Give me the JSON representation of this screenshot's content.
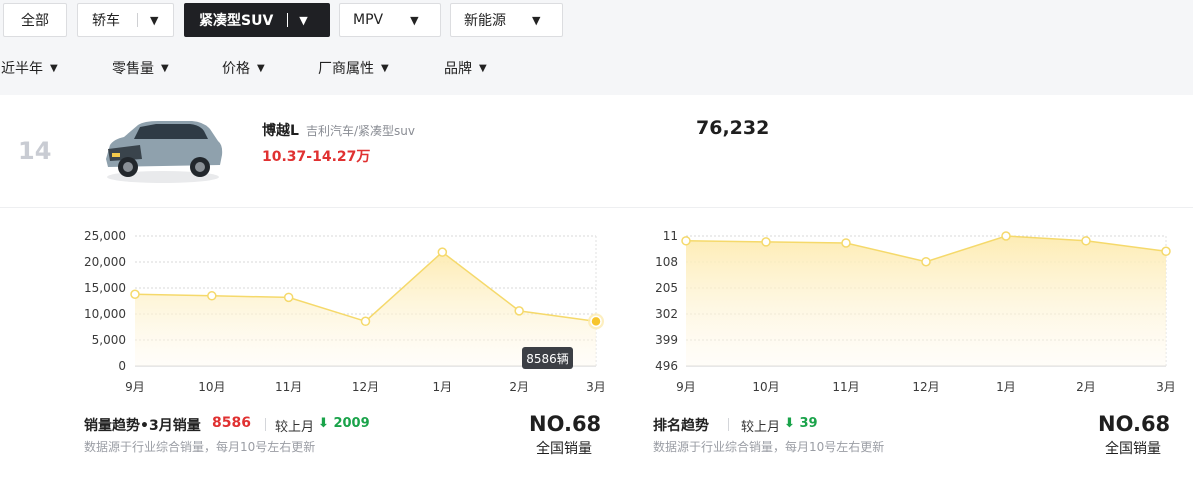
{
  "tabs": [
    {
      "label": "全部",
      "dropdown": false,
      "active": false
    },
    {
      "label": "轿车",
      "dropdown": true,
      "active": false
    },
    {
      "label": "紧凑型SUV",
      "dropdown": true,
      "active": true
    },
    {
      "label": "MPV",
      "dropdown": true,
      "active": false
    },
    {
      "label": "新能源",
      "dropdown": true,
      "active": false
    }
  ],
  "filters": [
    "近半年",
    "零售量",
    "价格",
    "厂商属性",
    "品牌"
  ],
  "item": {
    "rank": "14",
    "name": "博越L",
    "maker": "吉利汽车/紧凑型suv",
    "price": "10.37-14.27万",
    "sales": "76,232"
  },
  "tooltip": "8586辆",
  "sales_footer": {
    "title": "销量趋势•3月销量",
    "value": "8586",
    "compare_label": "较上月",
    "delta": "2009",
    "source": "数据源于行业综合销量，每月10号左右更新",
    "no": "NO.68",
    "no_label": "全国销量"
  },
  "rank_footer": {
    "title": "排名趋势",
    "compare_label": "较上月",
    "delta": "39",
    "source": "数据源于行业综合销量，每月10号左右更新",
    "no": "NO.68",
    "no_label": "全国销量"
  },
  "colors": {
    "line": "#f5d96b",
    "fill_top": "#fdebb0",
    "active_point": "#f7c52c",
    "down": "#1aa34a",
    "price": "#e03131"
  },
  "chart_data": [
    {
      "type": "area",
      "categories": [
        "9月",
        "10月",
        "11月",
        "12月",
        "1月",
        "2月",
        "3月"
      ],
      "values": [
        13800,
        13500,
        13200,
        8600,
        21900,
        10600,
        8586
      ],
      "yticks": [
        "0",
        "5,000",
        "10,000",
        "15,000",
        "20,000",
        "25,000"
      ],
      "ylim": [
        0,
        25000
      ],
      "grid": true
    },
    {
      "type": "area",
      "categories": [
        "9月",
        "10月",
        "11月",
        "12月",
        "1月",
        "2月",
        "3月"
      ],
      "values": [
        29,
        33,
        37,
        107,
        11,
        29,
        68
      ],
      "yticks": [
        "11",
        "108",
        "205",
        "302",
        "399",
        "496"
      ],
      "ylim": [
        496,
        11
      ],
      "inverted": true,
      "grid": true
    }
  ]
}
